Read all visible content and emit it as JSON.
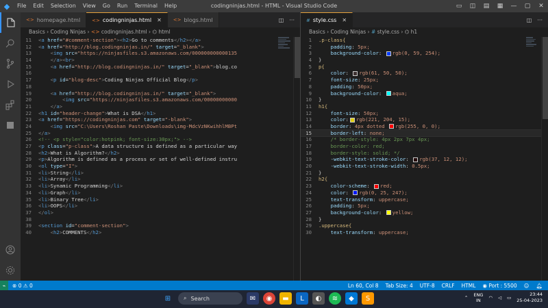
{
  "titlebar": {
    "menu": [
      "File",
      "Edit",
      "Selection",
      "View",
      "Go",
      "Run",
      "Terminal",
      "Help"
    ],
    "window_title": "codingninjas.html - HTML - Visual Studio Code"
  },
  "left_editor": {
    "tabs": [
      {
        "label": "homepage.html",
        "active": false
      },
      {
        "label": "codingninjas.html",
        "active": true
      },
      {
        "label": "blogs.html",
        "active": false
      }
    ],
    "breadcrumb": [
      "Basics",
      "Coding Ninjas",
      "codingninjas.html",
      "html"
    ]
  },
  "right_editor": {
    "tabs": [
      {
        "label": "style.css",
        "active": true
      }
    ],
    "breadcrumb": [
      "Basics",
      "Coding Ninjas",
      "style.css",
      "h1"
    ]
  },
  "html_lines": [
    {
      "n": "11",
      "text": "<a href=\"#comment-section\"><h2>Go to comments</h2></a>"
    },
    {
      "n": "12",
      "text": "<a href=\"http://blog.codingninjas.in/\" target=\"_blank\">"
    },
    {
      "n": "13",
      "text": "    <img src=\"https://ninjasfiles.s3.amazonaws.com/000000000000135"
    },
    {
      "n": "14",
      "text": "    </a><br>"
    },
    {
      "n": "15",
      "text": "    <a href=\"http://blog.codingninjas.in/\" target=\"_blank\">blog.co"
    },
    {
      "n": "16",
      "text": ""
    },
    {
      "n": "17",
      "text": "    <p id=\"blog-desc\">Coding Ninjas Official Blog</p>"
    },
    {
      "n": "18",
      "text": ""
    },
    {
      "n": "19",
      "text": "    <a href=\"http://blog.codingninjas.in/\" target=\"_blank\">"
    },
    {
      "n": "20",
      "text": "        <img src=\"https://ninjasfiles.s3.amazonaws.com/00000000000"
    },
    {
      "n": "21",
      "text": "    </a>"
    },
    {
      "n": "22",
      "text": "<h1 id=\"header-change\">What is DSA</h1>"
    },
    {
      "n": "23",
      "text": "<a href=\"https://codingninjas.com\" target=\"-blank\">"
    },
    {
      "n": "24",
      "text": "    <img src=\"C:\\Users\\Roshan Paste\\Downloads\\img-MdcVzNKwihhlMBPt"
    },
    {
      "n": "25",
      "text": "</a>"
    },
    {
      "n": "26",
      "text": "<!-- <p style=\"color:hotpink; font-size:30px;\"> -->"
    },
    {
      "n": "27",
      "text": "<p class=\"p-class\">A data structure is defined as a particular way"
    },
    {
      "n": "28",
      "text": "<h2>What is Algorithm?</h2>"
    },
    {
      "n": "29",
      "text": "<p>Algorithm is defined as a process or set of well-defined instru"
    },
    {
      "n": "30",
      "text": "<ol type=\"I\">"
    },
    {
      "n": "31",
      "text": "<li>String</li>"
    },
    {
      "n": "32",
      "text": "<li>Array</li>"
    },
    {
      "n": "33",
      "text": "<li>Synamic Programming</li>"
    },
    {
      "n": "34",
      "text": "<li>Graph</li>"
    },
    {
      "n": "35",
      "text": "<li>Binary Tree</li>"
    },
    {
      "n": "36",
      "text": "<li>OOPS</li>"
    },
    {
      "n": "37",
      "text": "</ol>"
    },
    {
      "n": "38",
      "text": ""
    },
    {
      "n": "39",
      "text": "<section id=\"comment-section\">"
    },
    {
      "n": "40",
      "text": "    <h2>COMMENTS</h2>"
    }
  ],
  "css_lines": [
    {
      "n": "1",
      "text": ".p-class{"
    },
    {
      "n": "2",
      "text": "    padding: 5px;"
    },
    {
      "n": "3",
      "text": "    background-color: ",
      "swatch": "#003bfe",
      "after": "rgb(0, 59, 254);"
    },
    {
      "n": "4",
      "text": "}"
    },
    {
      "n": "5",
      "text": "p{"
    },
    {
      "n": "6",
      "text": "    color: ",
      "swatch": "#3d3232",
      "after": "rgb(61, 50, 50);"
    },
    {
      "n": "7",
      "text": "    font-size: 25px;"
    },
    {
      "n": "8",
      "text": "    padding: 50px;"
    },
    {
      "n": "9",
      "text": "    background-color: ",
      "swatch": "#00ffff",
      "after": "aqua;"
    },
    {
      "n": "10",
      "text": "}"
    },
    {
      "n": "11",
      "text": "h1{"
    },
    {
      "n": "12",
      "text": "    font-size: 50px;"
    },
    {
      "n": "13",
      "text": "    color:",
      "swatch": "#ddcc0f",
      "after": "rgb(221, 204, 15);"
    },
    {
      "n": "14",
      "text": "    border: 4px dotted ",
      "swatch": "#ff0000",
      "after": "rgb(255, 0, 0);"
    },
    {
      "n": "15",
      "text": "    border-left: none;",
      "current": true
    },
    {
      "n": "16",
      "text": "    /* border-style: 4px 2px 7px 4px;"
    },
    {
      "n": "17",
      "text": "    border-color: red;"
    },
    {
      "n": "18",
      "text": "    border-style: solid; */"
    },
    {
      "n": "19",
      "text": "    -webkit-text-stroke-color: ",
      "swatch": "#250c0c",
      "after": "rgb(37, 12, 12);"
    },
    {
      "n": "20",
      "text": "    -webkit-text-stroke-width: 0.5px;"
    },
    {
      "n": "21",
      "text": "}"
    },
    {
      "n": "22",
      "text": "h2{"
    },
    {
      "n": "23",
      "text": "    color-scheme: ",
      "swatch": "#ff0000",
      "after": "red;"
    },
    {
      "n": "24",
      "text": "    color: ",
      "swatch": "#0019f7",
      "after": "rgb(0, 25, 247);"
    },
    {
      "n": "25",
      "text": "    text-transform: uppercase;"
    },
    {
      "n": "26",
      "text": "    padding: 5px;"
    },
    {
      "n": "27",
      "text": "    background-color: ",
      "swatch": "#ffff00",
      "after": "yellow;"
    },
    {
      "n": "28",
      "text": "}"
    },
    {
      "n": "29",
      "text": ".uppercase{"
    },
    {
      "n": "30",
      "text": "    text-transform: uppercase;"
    }
  ],
  "status": {
    "errors": "0",
    "warnings": "0",
    "position": "Ln 60, Col 8",
    "tab_size": "Tab Size: 4",
    "encoding": "UTF-8",
    "eol": "CRLF",
    "language": "HTML",
    "port": "Port : 5500"
  },
  "taskbar": {
    "search_label": "Search",
    "lang_top": "ENG",
    "lang_bottom": "IN",
    "time": "23:44",
    "date": "25-04-2023"
  },
  "colors": {
    "accent": "#007acc",
    "tab_active_border": "#e8a33d"
  }
}
